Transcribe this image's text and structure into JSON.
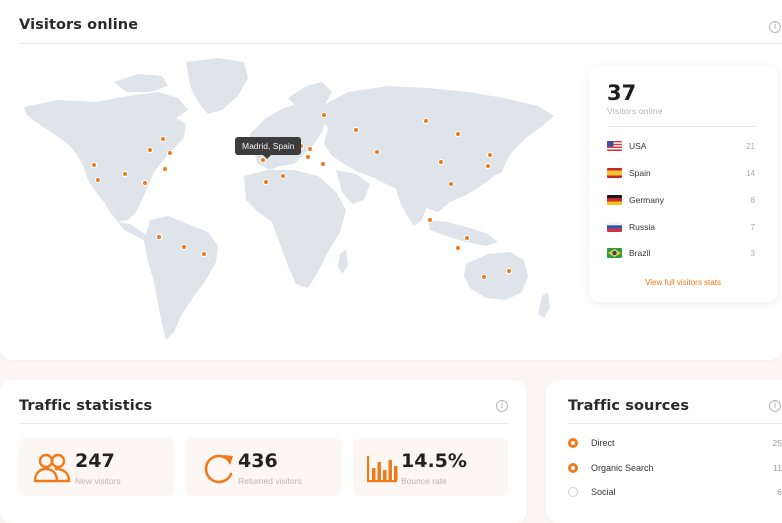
{
  "visitors_online": {
    "title": "Visitors online",
    "tooltip": "Madrid, Spain",
    "count": "37",
    "count_label": "Visitors online",
    "countries": [
      {
        "name": "USA",
        "count": "21",
        "flag": "usa"
      },
      {
        "name": "Spain",
        "count": "14",
        "flag": "spain"
      },
      {
        "name": "Germany",
        "count": "8",
        "flag": "germany"
      },
      {
        "name": "Russia",
        "count": "7",
        "flag": "russia"
      },
      {
        "name": "Brazil",
        "count": "3",
        "flag": "brazil"
      }
    ],
    "link": "View full visitors stats"
  },
  "traffic_statistics": {
    "title": "Traffic statistics",
    "stats": [
      {
        "value": "247",
        "label": "New visitors",
        "icon": "users-icon"
      },
      {
        "value": "436",
        "label": "Returned visitors",
        "icon": "refresh-icon"
      },
      {
        "value": "14.5%",
        "label": "Bounce rate",
        "icon": "bar-chart-icon"
      }
    ]
  },
  "traffic_sources": {
    "title": "Traffic sources",
    "sources": [
      {
        "name": "Direct",
        "count": "25",
        "selected": true
      },
      {
        "name": "Organic Search",
        "count": "11",
        "selected": true
      },
      {
        "name": "Social",
        "count": "6",
        "selected": false
      }
    ]
  },
  "colors": {
    "accent": "#f07a1c",
    "map_land": "#dfe3ea",
    "background": "#fbf6f3"
  }
}
